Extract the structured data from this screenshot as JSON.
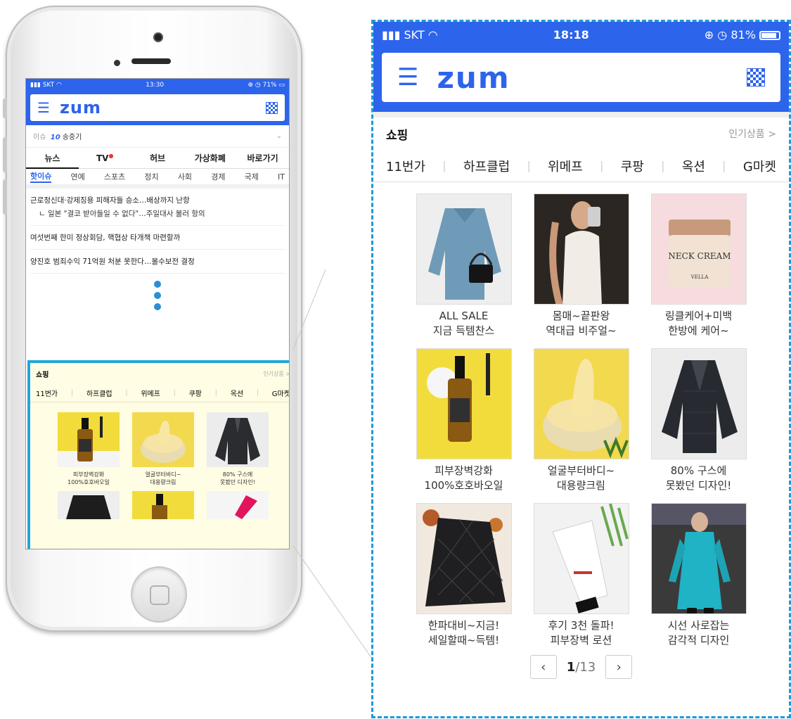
{
  "phone": {
    "status": {
      "carrier": "SKT",
      "time": "13:30",
      "battery": "71%"
    },
    "header": {
      "logo": "zum"
    },
    "issue": {
      "label": "이슈",
      "rank": "10",
      "text": "송중기"
    },
    "tabs": [
      "뉴스",
      "TV",
      "허브",
      "가상화폐",
      "바로가기"
    ],
    "categories": [
      "핫이슈",
      "연예",
      "스포츠",
      "정치",
      "사회",
      "경제",
      "국제",
      "IT"
    ],
    "news": [
      {
        "headline": "근로정신대·강제징용 피해자들 승소…배상까지 난항",
        "sub": "ㄴ 일본 \"결코 받아들일 수 없다\"…주일대사 불러 항의"
      },
      {
        "headline": "여섯번째 한미 정상회담, 핵협상 타개책 마련할까"
      },
      {
        "headline": "양진호 범죄수익 71억원 처분 못한다…몰수보전 결정"
      }
    ],
    "shopping": {
      "title": "쇼핑",
      "more": "인기상품 >",
      "stores": [
        "11번가",
        "하프클럽",
        "위메프",
        "쿠팡",
        "옥션",
        "G마켓"
      ],
      "items": [
        {
          "line1": "피부장벽강화",
          "line2": "100%호호바오일"
        },
        {
          "line1": "얼굴부터바디~",
          "line2": "대용량크림"
        },
        {
          "line1": "80% 구스에",
          "line2": "못봤던 디자인!"
        }
      ]
    }
  },
  "zoom": {
    "status": {
      "carrier": "SKT",
      "time": "18:18",
      "battery": "81%"
    },
    "header": {
      "logo": "zum"
    },
    "shopping": {
      "title": "쇼핑",
      "more": "인기상품 >",
      "stores": [
        "11번가",
        "하프클럽",
        "위메프",
        "쿠팡",
        "옥션",
        "G마켓"
      ],
      "items": [
        {
          "line1": "ALL SALE",
          "line2": "지금 득템찬스"
        },
        {
          "line1": "몸매~끝판왕",
          "line2": "역대급 비주얼~"
        },
        {
          "line1": "링클케어+미백",
          "line2": "한방에 케어~"
        },
        {
          "line1": "피부장벽강화",
          "line2": "100%호호바오일"
        },
        {
          "line1": "얼굴부터바디~",
          "line2": "대용량크림"
        },
        {
          "line1": "80% 구스에",
          "line2": "못봤던 디자인!"
        },
        {
          "line1": "한파대비~지금!",
          "line2": "세일할때~득템!"
        },
        {
          "line1": "후기 3천 돌파!",
          "line2": "피부장벽 로션"
        },
        {
          "line1": "시선 사로잡는",
          "line2": "감각적 디자인"
        }
      ],
      "neck_cream_label": "NECK CREAM",
      "neck_cream_brand": "VELLA",
      "pager": {
        "current": "1",
        "total": "/13"
      }
    }
  },
  "colors": {
    "brand": "#2d64ec",
    "highlight": "#23a6dc",
    "shopping_bg": "#fffde3"
  }
}
